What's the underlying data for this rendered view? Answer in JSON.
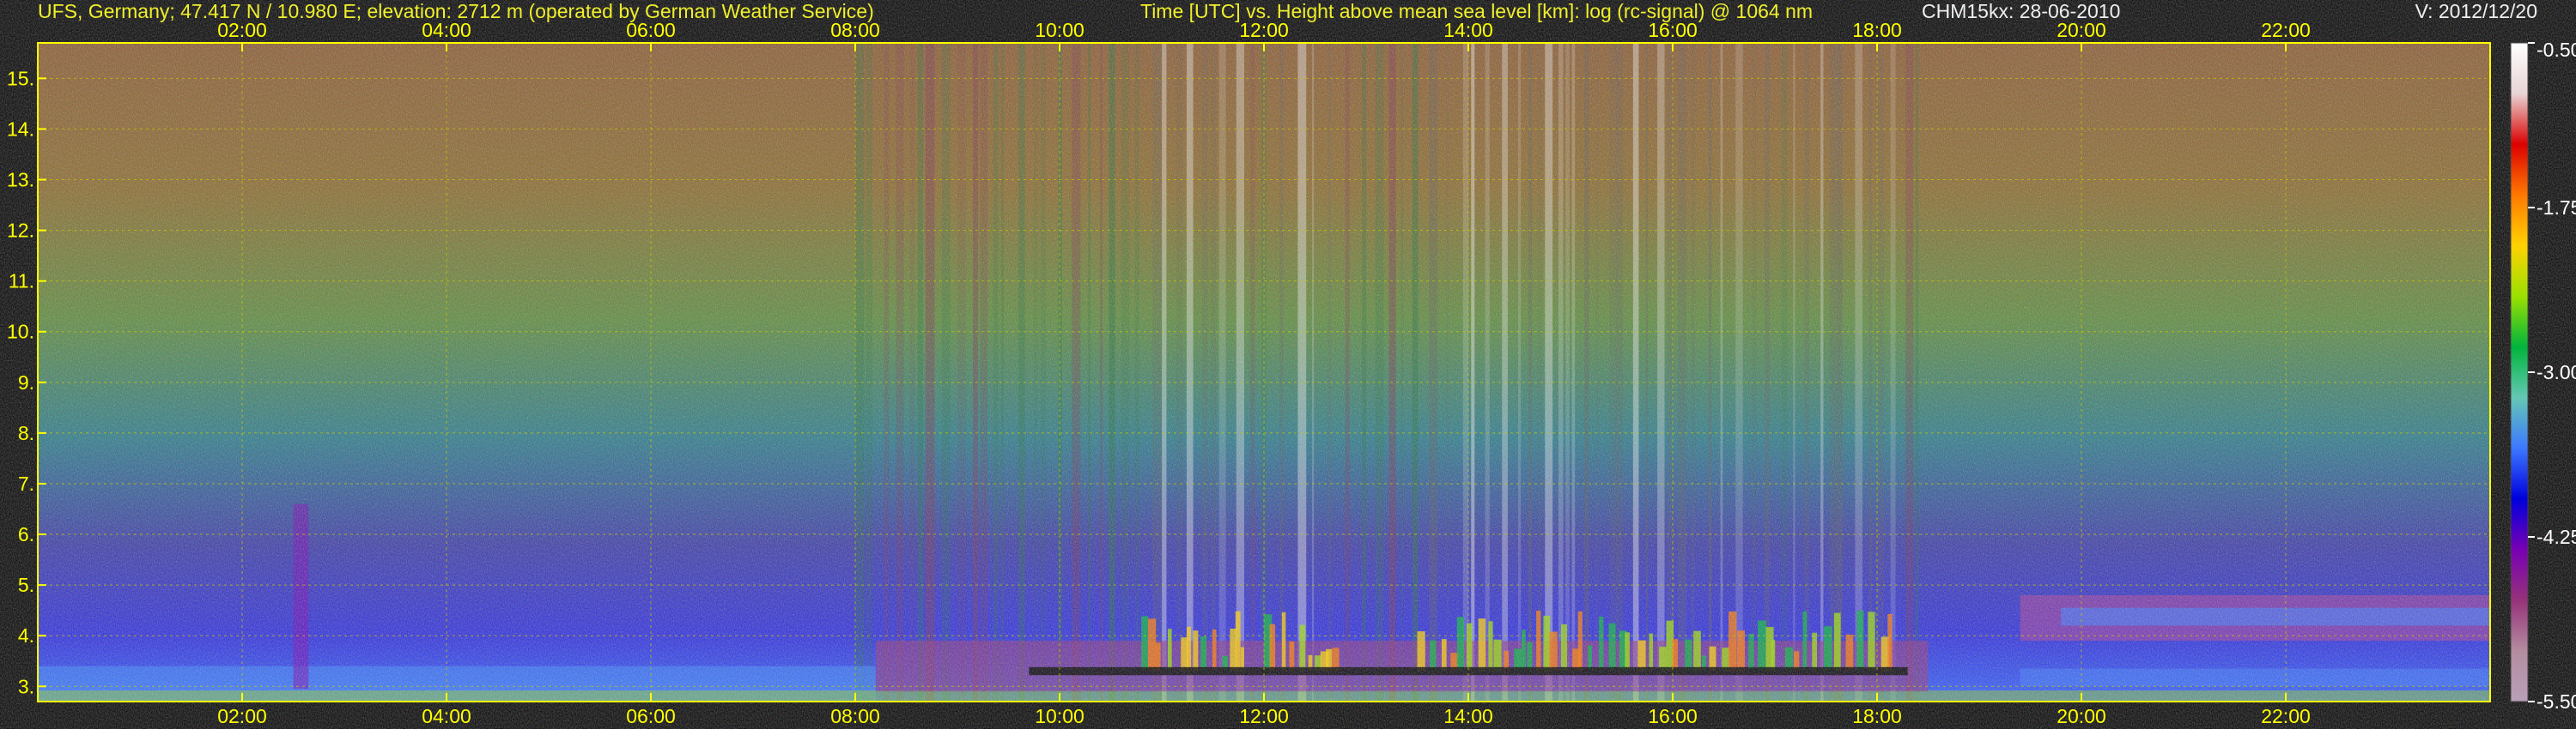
{
  "header": {
    "site": "UFS, Germany; 47.417 N / 10.980 E; elevation: 2712 m  (operated by German Weather Service)",
    "plot_description": "Time [UTC] vs. Height above mean sea level [km]: log (rc-signal) @ 1064 nm",
    "instrument_date": "CHM15kx: 28-06-2010",
    "version": "V: 2012/12/20"
  },
  "colors": {
    "background": "#000000",
    "header_text": "#ffff00",
    "white_text": "#ffffff",
    "axis_frame": "#ffff00",
    "grid": "#c8c800"
  },
  "chart_data": {
    "type": "heatmap",
    "title": "Time [UTC] vs. Height above mean sea level [km]: log (rc-signal) @ 1064 nm",
    "xlabel": "Time [UTC]",
    "ylabel": "Height above mean sea level [km]",
    "xlim": [
      0,
      24
    ],
    "ylim": [
      2.7,
      15.7
    ],
    "x_ticks": [
      2,
      4,
      6,
      8,
      10,
      12,
      14,
      16,
      18,
      20,
      22
    ],
    "x_tick_labels": [
      "02:00",
      "04:00",
      "06:00",
      "08:00",
      "10:00",
      "12:00",
      "14:00",
      "16:00",
      "18:00",
      "20:00",
      "22:00"
    ],
    "y_ticks": [
      3,
      4,
      5,
      6,
      7,
      8,
      9,
      10,
      11,
      12,
      13,
      14,
      15
    ],
    "y_tick_labels": [
      "3.",
      "4.",
      "5.",
      "6.",
      "7.",
      "8.",
      "9.",
      "10.",
      "11.",
      "12.",
      "13.",
      "14.",
      "15."
    ],
    "grid": true,
    "colorbar": {
      "range": [
        -5.5,
        -0.5
      ],
      "tick_values": [
        -0.5,
        -1.75,
        -3.0,
        -4.25,
        -5.5
      ],
      "tick_labels": [
        "-0.50",
        "-1.75",
        "-3.00",
        "-4.25",
        "-5.50"
      ],
      "palette_top_to_bottom": [
        "#ffffff",
        "#e8d4d4",
        "#dc0000",
        "#ff7800",
        "#ffd200",
        "#9be000",
        "#00b43c",
        "#64c8b4",
        "#3c78ff",
        "#0000dc",
        "#7800b4",
        "#96327a",
        "#b48ca0",
        "#b9a0b9"
      ]
    },
    "features": {
      "cloud_base_km": 3.3,
      "cloud_periods_utc": [
        [
          10.8,
          11.8
        ],
        [
          12.0,
          12.7
        ],
        [
          13.5,
          17.0
        ],
        [
          17.1,
          18.2
        ]
      ],
      "upper_layer_km": [
        3.9,
        4.8
      ],
      "upper_layer_utc": [
        19.4,
        24.0
      ]
    }
  }
}
